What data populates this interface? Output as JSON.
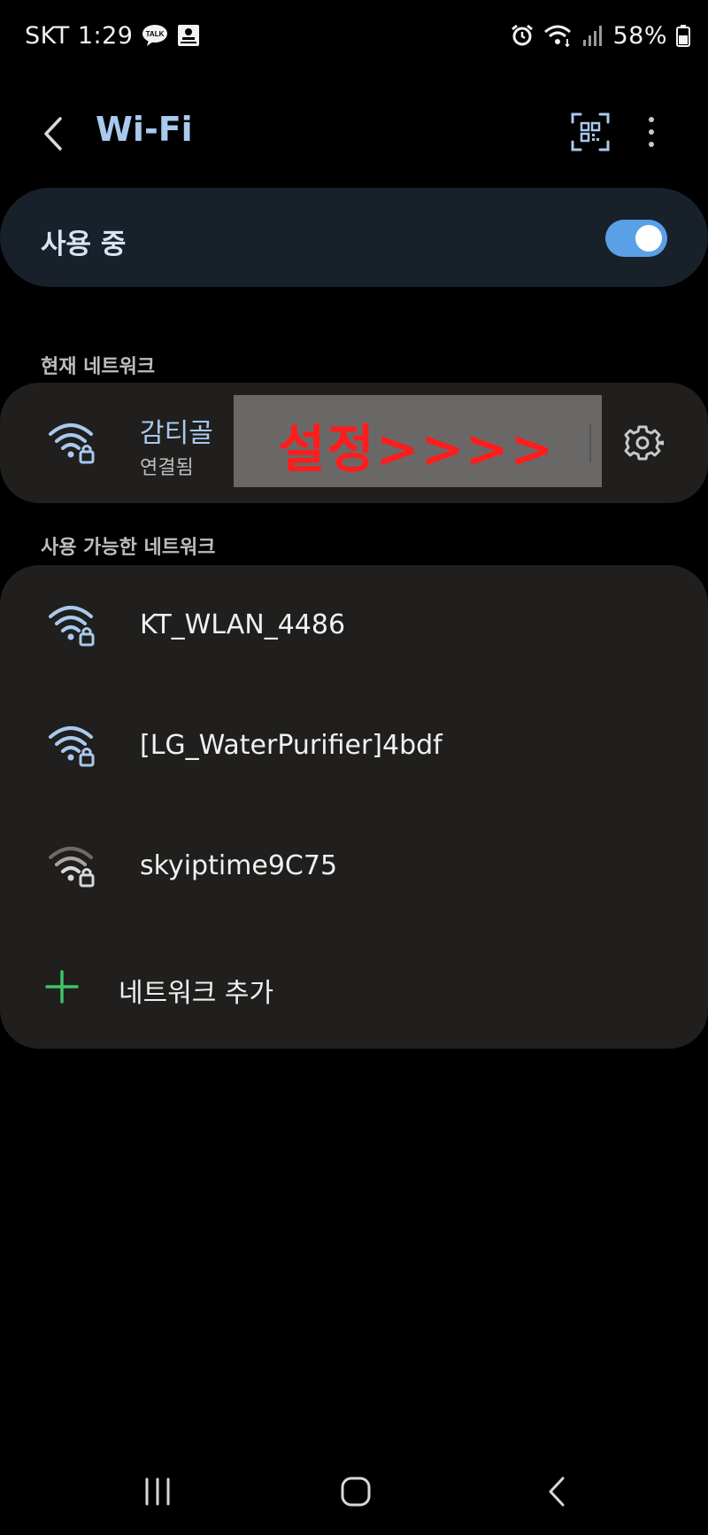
{
  "status_bar": {
    "carrier_time": "SKT 1:29",
    "talk_badge": "TALK",
    "battery_percent": "58%"
  },
  "header": {
    "title": "Wi-Fi"
  },
  "wifi_toggle": {
    "label": "사용 중",
    "on": true,
    "accent": "#5aa0e6"
  },
  "current_network": {
    "section_label": "현재 네트워크",
    "name": "감티골",
    "status": "연결됨",
    "overlay_text": "설정>>>>"
  },
  "available_networks": {
    "section_label": "사용 가능한 네트워크",
    "items": [
      {
        "name": "KT_WLAN_4486",
        "icon": "wifi-lock-icon",
        "strength": "strong"
      },
      {
        "name": "[LG_WaterPurifier]4bdf",
        "icon": "wifi-lock-icon",
        "strength": "strong"
      },
      {
        "name": "skyiptime9C75",
        "icon": "wifi-lock-icon",
        "strength": "weak"
      }
    ],
    "add_label": "네트워크 추가"
  },
  "colors": {
    "accent_blue": "#a9c9ef",
    "overlay_red": "#ff1c1c",
    "plus_green": "#3cc46a"
  }
}
